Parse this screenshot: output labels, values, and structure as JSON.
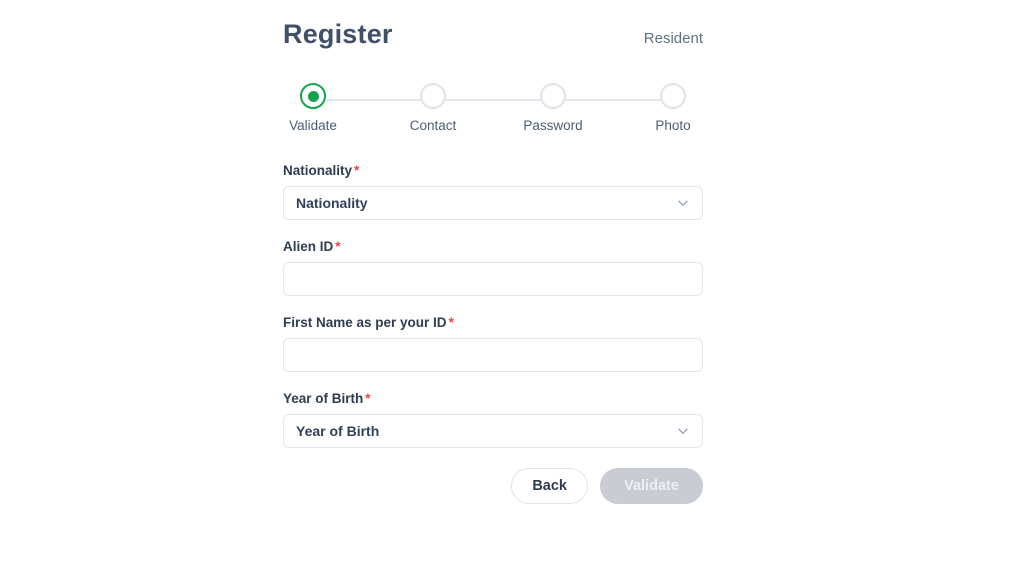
{
  "header": {
    "title": "Register",
    "account_type": "Resident"
  },
  "stepper": {
    "active_index": 0,
    "steps": [
      {
        "label": "Validate",
        "state": "active"
      },
      {
        "label": "Contact",
        "state": "inactive"
      },
      {
        "label": "Password",
        "state": "inactive"
      },
      {
        "label": "Photo",
        "state": "inactive"
      }
    ]
  },
  "form": {
    "required_marker": "*",
    "fields": [
      {
        "label": "Nationality",
        "required": true,
        "type": "select",
        "value": "Nationality",
        "placeholder": "Nationality",
        "icon": "chevron-down-icon"
      },
      {
        "label": "Alien ID",
        "required": true,
        "type": "text",
        "value": "",
        "placeholder": ""
      },
      {
        "label": "First Name as per your ID",
        "required": true,
        "type": "text",
        "value": "",
        "placeholder": ""
      },
      {
        "label": "Year of Birth",
        "required": true,
        "type": "select",
        "value": "Year of Birth",
        "placeholder": "Year of Birth",
        "icon": "chevron-down-icon"
      }
    ]
  },
  "actions": {
    "back_label": "Back",
    "validate_label": "Validate",
    "validate_disabled": true
  },
  "colors": {
    "accent_green": "#14a44d",
    "required_red": "#f0443c",
    "title_slate": "#3f5068",
    "label_navy": "#2f3c52",
    "border_grey": "#e2e5ea",
    "disabled_grey": "#c9ccd3",
    "track_grey": "#e4e7ec"
  }
}
